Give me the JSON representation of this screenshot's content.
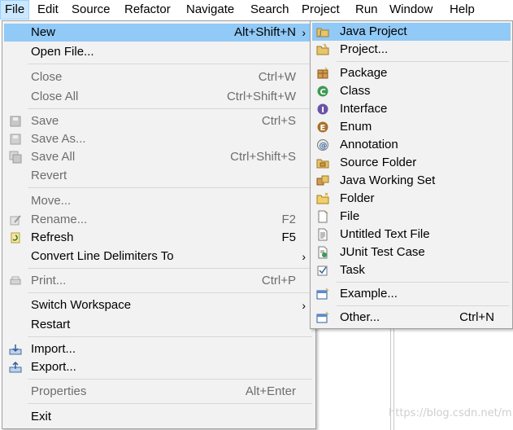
{
  "menubar": {
    "items": [
      "File",
      "Edit",
      "Source",
      "Refactor",
      "Navigate",
      "Search",
      "Project",
      "Run",
      "Window",
      "Help"
    ]
  },
  "file_menu": {
    "new": {
      "label": "New",
      "accel": "Alt+Shift+N"
    },
    "open_file": {
      "label": "Open File..."
    },
    "close": {
      "label": "Close",
      "accel": "Ctrl+W"
    },
    "close_all": {
      "label": "Close All",
      "accel": "Ctrl+Shift+W"
    },
    "save": {
      "label": "Save",
      "accel": "Ctrl+S"
    },
    "save_as": {
      "label": "Save As..."
    },
    "save_all": {
      "label": "Save All",
      "accel": "Ctrl+Shift+S"
    },
    "revert": {
      "label": "Revert"
    },
    "move": {
      "label": "Move..."
    },
    "rename": {
      "label": "Rename...",
      "accel": "F2"
    },
    "refresh": {
      "label": "Refresh",
      "accel": "F5"
    },
    "convert": {
      "label": "Convert Line Delimiters To"
    },
    "print": {
      "label": "Print...",
      "accel": "Ctrl+P"
    },
    "switch_workspace": {
      "label": "Switch Workspace"
    },
    "restart": {
      "label": "Restart"
    },
    "import": {
      "label": "Import..."
    },
    "export": {
      "label": "Export..."
    },
    "properties": {
      "label": "Properties",
      "accel": "Alt+Enter"
    },
    "exit": {
      "label": "Exit"
    }
  },
  "new_submenu": {
    "java_project": {
      "label": "Java Project",
      "icon": "java-project-icon"
    },
    "project": {
      "label": "Project...",
      "icon": "project-icon"
    },
    "package": {
      "label": "Package",
      "icon": "package-icon"
    },
    "class": {
      "label": "Class",
      "icon": "class-icon"
    },
    "interface": {
      "label": "Interface",
      "icon": "interface-icon"
    },
    "enum": {
      "label": "Enum",
      "icon": "enum-icon"
    },
    "annotation": {
      "label": "Annotation",
      "icon": "annotation-icon"
    },
    "source_folder": {
      "label": "Source Folder",
      "icon": "source-folder-icon"
    },
    "java_working_set": {
      "label": "Java Working Set",
      "icon": "working-set-icon"
    },
    "folder": {
      "label": "Folder",
      "icon": "folder-icon"
    },
    "file": {
      "label": "File",
      "icon": "file-icon"
    },
    "untitled_text_file": {
      "label": "Untitled Text File",
      "icon": "text-file-icon"
    },
    "junit_test_case": {
      "label": "JUnit Test Case",
      "icon": "junit-icon"
    },
    "task": {
      "label": "Task",
      "icon": "task-icon"
    },
    "example": {
      "label": "Example...",
      "icon": "example-icon"
    },
    "other": {
      "label": "Other...",
      "accel": "Ctrl+N",
      "icon": "other-icon"
    }
  },
  "colors": {
    "menu_bg": "#f2f2f2",
    "highlight": "#91c9f7",
    "disabled_text": "#6d6d6d",
    "menubar_active": "#cce8ff"
  },
  "watermark": "https://blog.csdn.net/m"
}
